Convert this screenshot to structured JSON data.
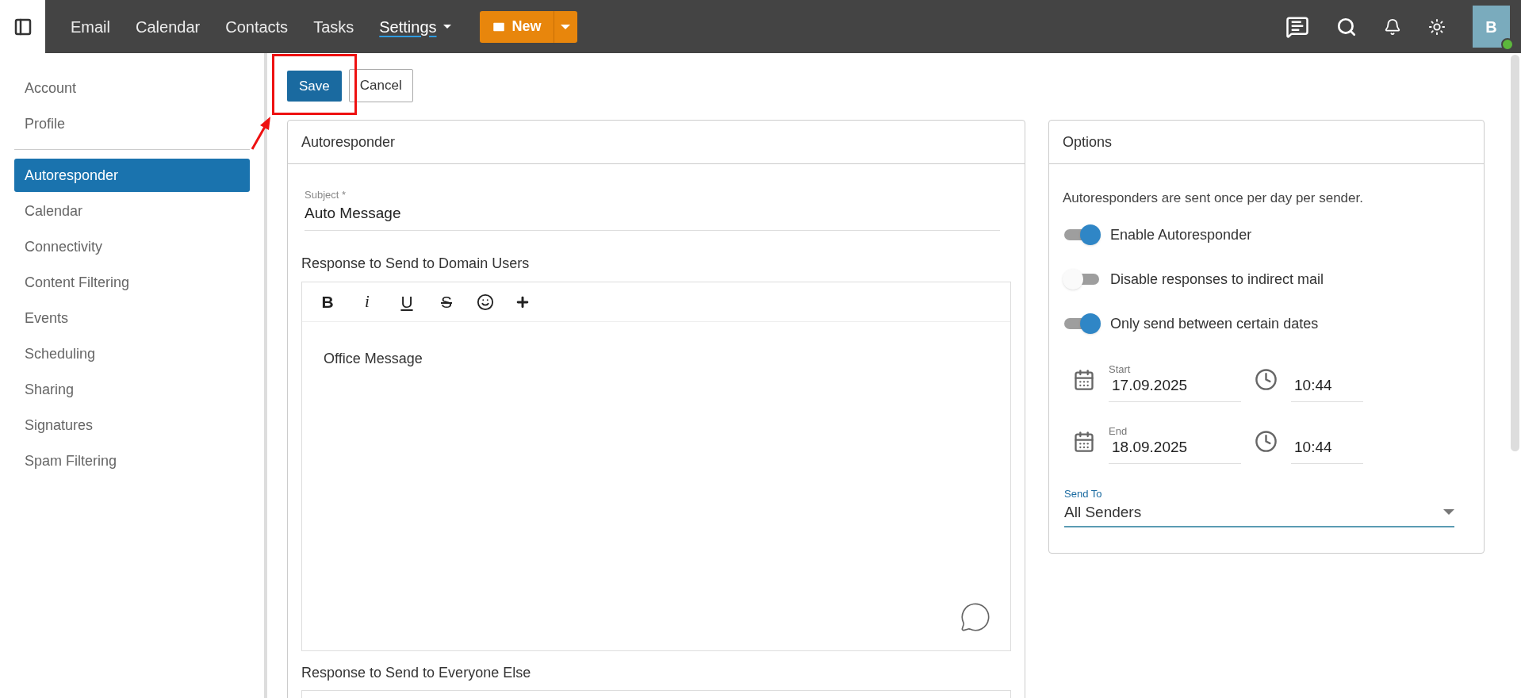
{
  "topbar": {
    "nav": [
      {
        "label": "Email",
        "selected": false
      },
      {
        "label": "Calendar",
        "selected": false
      },
      {
        "label": "Contacts",
        "selected": false
      },
      {
        "label": "Tasks",
        "selected": false
      },
      {
        "label": "Settings",
        "selected": true
      }
    ],
    "new_button": "New",
    "avatar": {
      "initial": "B",
      "online": true
    }
  },
  "sidebar": {
    "groups": [
      [
        {
          "label": "Account",
          "selected": false
        },
        {
          "label": "Profile",
          "selected": false
        }
      ],
      [
        {
          "label": "Autoresponder",
          "selected": true
        },
        {
          "label": "Calendar",
          "selected": false
        },
        {
          "label": "Connectivity",
          "selected": false
        },
        {
          "label": "Content Filtering",
          "selected": false
        },
        {
          "label": "Events",
          "selected": false
        },
        {
          "label": "Scheduling",
          "selected": false
        },
        {
          "label": "Sharing",
          "selected": false
        },
        {
          "label": "Signatures",
          "selected": false
        },
        {
          "label": "Spam Filtering",
          "selected": false
        }
      ]
    ]
  },
  "actions": {
    "save": "Save",
    "cancel": "Cancel"
  },
  "autoresponder": {
    "title": "Autoresponder",
    "subject": {
      "label": "Subject *",
      "value": "Auto Message"
    },
    "domain_label": "Response to Send to Domain Users",
    "format_buttons": [
      {
        "kind": "bold",
        "label": "B"
      },
      {
        "kind": "italic",
        "label": "i"
      },
      {
        "kind": "underline",
        "label": "U"
      },
      {
        "kind": "strike",
        "label": "S"
      },
      {
        "kind": "emoji"
      },
      {
        "kind": "plus"
      }
    ],
    "domain_body": "Office Message",
    "everyone_label": "Response to Send to Everyone Else"
  },
  "options": {
    "title": "Options",
    "note": "Autoresponders are sent once per day per sender.",
    "toggles": [
      {
        "label": "Enable Autoresponder",
        "on": true
      },
      {
        "label": "Disable responses to indirect mail",
        "on": false
      },
      {
        "label": "Only send between certain dates",
        "on": true
      }
    ],
    "ranges": [
      {
        "label": "Start",
        "date": "17.09.2025",
        "time": "10:44"
      },
      {
        "label": "End",
        "date": "18.09.2025",
        "time": "10:44"
      }
    ],
    "send_to": {
      "label": "Send To",
      "value": "All Senders"
    }
  }
}
